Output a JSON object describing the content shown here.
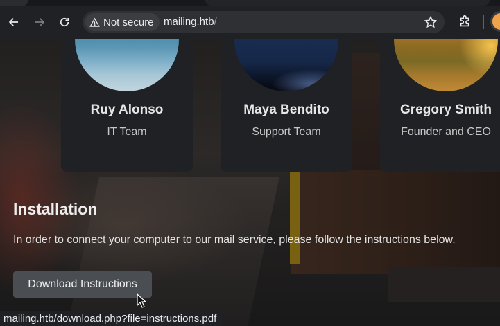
{
  "browser": {
    "security_label": "Not secure",
    "url_host": "mailing.htb",
    "url_path": "/",
    "status_url": "mailing.htb/download.php?file=instructions.pdf"
  },
  "team": [
    {
      "name": "Ruy Alonso",
      "role": "IT Team",
      "photo": "lake-photo"
    },
    {
      "name": "Maya Bendito",
      "role": "Support Team",
      "photo": "night-sky-photo"
    },
    {
      "name": "Gregory Smith",
      "role": "Founder and CEO",
      "photo": "sunset-field-photo"
    }
  ],
  "installation": {
    "title": "Installation",
    "text": "In order to connect your computer to our mail service, please follow the instructions below.",
    "button_label": "Download Instructions"
  },
  "colors": {
    "card_bg": "#1f2124",
    "button_bg": "#4a4e52",
    "chrome_bg": "#202124"
  }
}
